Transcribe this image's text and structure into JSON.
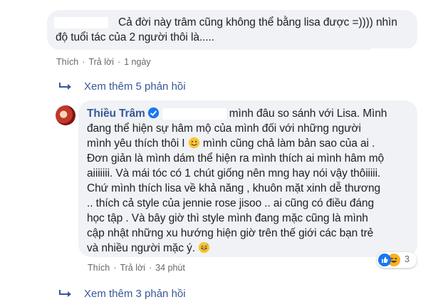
{
  "comment1": {
    "line1": "Cả đời này trâm cũng không thể bằng lisa được =)))) nhìn",
    "line2": "độ tuổi tác của 2 người thôi là.....",
    "actions": {
      "like": "Thích",
      "reply": "Trả lời",
      "time": "1 ngày"
    }
  },
  "more_replies_1": "Xem thêm 5 phản hồi",
  "comment2": {
    "author": "Thiều Trâm",
    "line1": "mình đâu so sánh với Lisa. Mình",
    "line2": "đang thể hiện sự hâm mộ của mình đối với những người",
    "line3a": "mình yêu thích thôi I",
    "line3b": "mình cũng chả làm bản sao của ai .",
    "line4": "Đơn giản là mình dám thể hiện ra mình thích ai mình hâm mộ",
    "line5": "aiiiiiii. Và mái tóc có 1 chút giống nên mng hay nói vậy thôiiiii.",
    "line6": "Chứ mình thích lisa về khả năng , khuôn mặt xinh dễ thương",
    "line7": ".. thích cả style của jennie rose jisoo .. ai cũng có điều đáng",
    "line8": "học tập . Và bây giờ thì style mình đang mặc cũng là mình",
    "line9": "cập nhật những xu hướng hiện giờ trên thế giới các bạn trẻ",
    "line10": "và nhiều người mặc ý.",
    "actions": {
      "like": "Thích",
      "reply": "Trả lời",
      "time": "34 phút"
    },
    "reaction_count": "3"
  },
  "more_replies_2": "Xem thêm 3 phản hồi",
  "colors": {
    "link": "#385898",
    "bubble": "#f0f2f5",
    "meta": "#65676b",
    "like": "#1877f2",
    "haha": "#f7b125"
  }
}
